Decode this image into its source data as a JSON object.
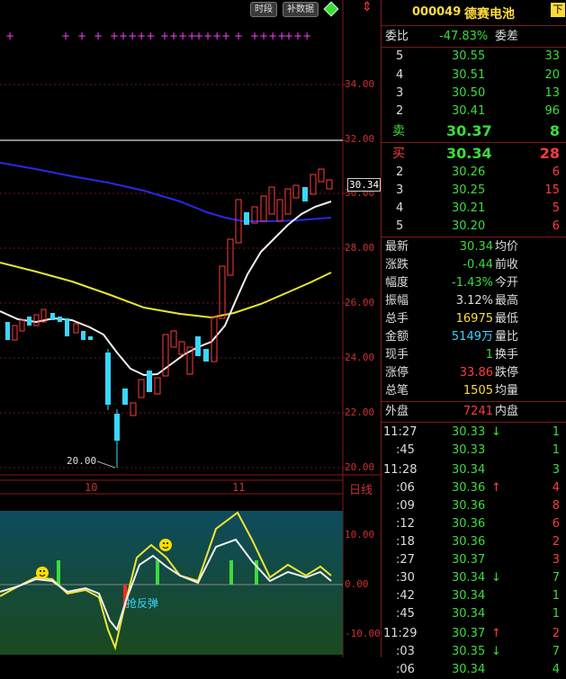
{
  "toolbar": {
    "btn1": "时段",
    "btn2": "补数据"
  },
  "header": {
    "code": "000049",
    "name": "德赛电池",
    "corner": "下"
  },
  "price_axis": {
    "labels": [
      "34.00",
      "32.00",
      "30.00",
      "28.00",
      "26.00",
      "24.00",
      "22.00",
      "20.00"
    ],
    "current_tag": "30.34"
  },
  "main_chart": {
    "low_mark": "20.00",
    "date_labels": [
      "10",
      "11"
    ],
    "period": "日线"
  },
  "indicator": {
    "axis_labels": [
      "10.00",
      "0.00",
      "-10.00"
    ],
    "signal_text": "抢反弹"
  },
  "order_book": {
    "weibi_label": "委比",
    "weibi_value": "-47.83%",
    "weicha_label": "委差",
    "asks": [
      {
        "level": "5",
        "price": "30.55",
        "vol": "33"
      },
      {
        "level": "4",
        "price": "30.51",
        "vol": "20"
      },
      {
        "level": "3",
        "price": "30.50",
        "vol": "13"
      },
      {
        "level": "2",
        "price": "30.41",
        "vol": "96"
      },
      {
        "level": "卖",
        "price": "30.37",
        "vol": "8"
      }
    ],
    "bids": [
      {
        "level": "买",
        "price": "30.34",
        "vol": "28"
      },
      {
        "level": "2",
        "price": "30.26",
        "vol": "6"
      },
      {
        "level": "3",
        "price": "30.25",
        "vol": "15"
      },
      {
        "level": "4",
        "price": "30.21",
        "vol": "5"
      },
      {
        "level": "5",
        "price": "30.20",
        "vol": "6"
      }
    ]
  },
  "stats": [
    {
      "l": "最新",
      "v": "30.34",
      "r": "均价"
    },
    {
      "l": "涨跌",
      "v": "-0.44",
      "r": "前收"
    },
    {
      "l": "幅度",
      "v": "-1.43%",
      "r": "今开"
    },
    {
      "l": "振幅",
      "v": "3.12%",
      "r": "最高"
    },
    {
      "l": "总手",
      "v": "16975",
      "r": "最低"
    },
    {
      "l": "金额",
      "v": "5149万",
      "r": "量比"
    },
    {
      "l": "现手",
      "v": "1",
      "r": "换手"
    },
    {
      "l": "涨停",
      "v": "33.86",
      "r": "跌停"
    },
    {
      "l": "总笔",
      "v": "1505",
      "r": "均量"
    }
  ],
  "waipan": {
    "label": "外盘",
    "value": "7241",
    "inner_label": "内盘"
  },
  "ticks": [
    {
      "t": "11:27",
      "p": "30.33",
      "a": "↓",
      "v": "1"
    },
    {
      "t": ":45",
      "p": "30.33",
      "a": "",
      "v": "1"
    },
    {
      "t": "11:28",
      "p": "30.34",
      "a": "",
      "v": "3"
    },
    {
      "t": ":06",
      "p": "30.36",
      "a": "↑",
      "v": "4"
    },
    {
      "t": ":09",
      "p": "30.36",
      "a": "",
      "v": "8"
    },
    {
      "t": ":12",
      "p": "30.36",
      "a": "",
      "v": "6"
    },
    {
      "t": ":18",
      "p": "30.36",
      "a": "",
      "v": "2"
    },
    {
      "t": ":27",
      "p": "30.37",
      "a": "",
      "v": "3"
    },
    {
      "t": ":30",
      "p": "30.34",
      "a": "↓",
      "v": "7"
    },
    {
      "t": ":42",
      "p": "30.34",
      "a": "",
      "v": "1"
    },
    {
      "t": ":45",
      "p": "30.34",
      "a": "",
      "v": "1"
    },
    {
      "t": "11:29",
      "p": "30.37",
      "a": "↑",
      "v": "2"
    },
    {
      "t": ":03",
      "p": "30.35",
      "a": "↓",
      "v": "7"
    },
    {
      "t": ":06",
      "p": "30.34",
      "a": "",
      "v": "4"
    }
  ]
}
